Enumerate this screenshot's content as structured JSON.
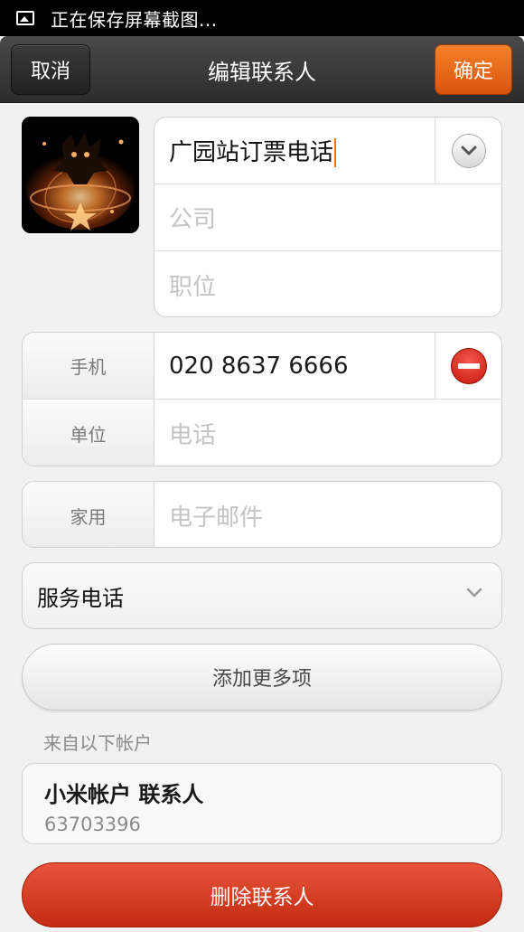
{
  "status_bar": {
    "text": "正在保存屏幕截图..."
  },
  "header": {
    "cancel_label": "取消",
    "title": "编辑联系人",
    "confirm_label": "确定"
  },
  "name_card": {
    "name_value": "广园站订票电话",
    "company_placeholder": "公司",
    "position_placeholder": "职位"
  },
  "phone_card": {
    "rows": [
      {
        "label": "手机",
        "value": "020 8637 6666"
      },
      {
        "label": "单位",
        "placeholder": "电话"
      }
    ]
  },
  "email_card": {
    "label": "家用",
    "placeholder": "电子邮件"
  },
  "group_select": {
    "value": "服务电话"
  },
  "add_more_label": "添加更多项",
  "account_section": {
    "label": "来自以下帐户",
    "account_name": "小米帐户 联系人",
    "account_id": "63703396"
  },
  "delete_label": "删除联系人",
  "colors": {
    "confirm": "#e8671a",
    "delete": "#d43a1f",
    "caret": "#e07a20"
  },
  "icons": [
    "image-icon",
    "chevron-down-circle-icon",
    "remove-circle-icon",
    "chevron-down-icon"
  ]
}
